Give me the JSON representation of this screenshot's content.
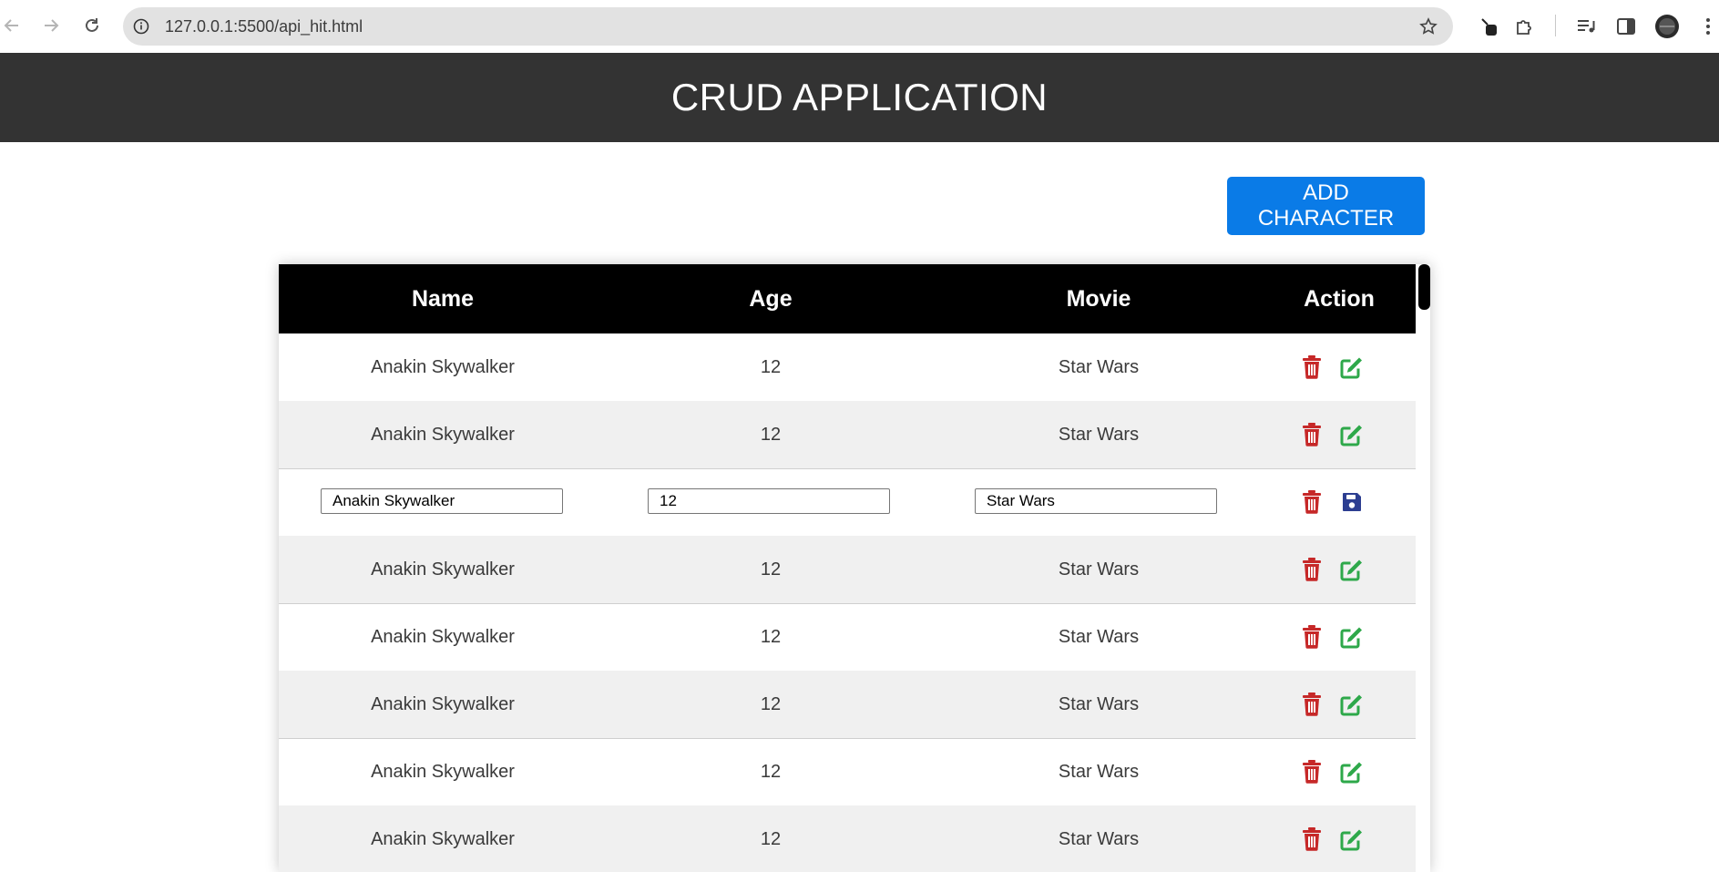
{
  "browser": {
    "url": "127.0.0.1:5500/api_hit.html",
    "back_icon": "arrow-left-icon",
    "forward_icon": "arrow-right-icon",
    "reload_icon": "reload-icon",
    "info_icon": "info-icon",
    "bookmark_icon": "star-icon"
  },
  "app": {
    "title": "CRUD APPLICATION",
    "add_button_label": "ADD CHARACTER"
  },
  "table": {
    "columns": [
      "Name",
      "Age",
      "Movie",
      "Action"
    ],
    "rows": [
      {
        "name": "Anakin Skywalker",
        "age": "12",
        "movie": "Star Wars",
        "editing": false
      },
      {
        "name": "Anakin Skywalker",
        "age": "12",
        "movie": "Star Wars",
        "editing": false
      },
      {
        "name": "Anakin Skywalker",
        "age": "12",
        "movie": "Star Wars",
        "editing": true
      },
      {
        "name": "Anakin Skywalker",
        "age": "12",
        "movie": "Star Wars",
        "editing": false
      },
      {
        "name": "Anakin Skywalker",
        "age": "12",
        "movie": "Star Wars",
        "editing": false
      },
      {
        "name": "Anakin Skywalker",
        "age": "12",
        "movie": "Star Wars",
        "editing": false
      },
      {
        "name": "Anakin Skywalker",
        "age": "12",
        "movie": "Star Wars",
        "editing": false
      },
      {
        "name": "Anakin Skywalker",
        "age": "12",
        "movie": "Star Wars",
        "editing": false
      }
    ]
  },
  "colors": {
    "header_bg": "#333333",
    "button_bg": "#0a7be7",
    "delete_icon": "#c62828",
    "edit_icon": "#2ea84a",
    "save_icon": "#2c3e91"
  }
}
